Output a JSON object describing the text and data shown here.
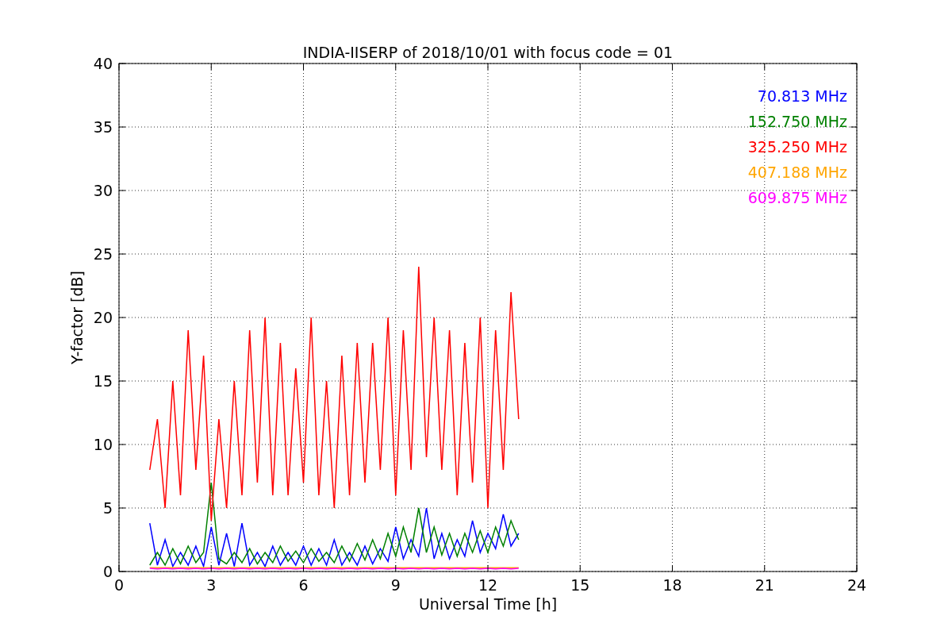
{
  "chart": {
    "chart_data": {
      "type": "line",
      "title": "INDIA-IISERP of 2018/10/01 with focus code = 01",
      "xlabel": "Universal Time [h]",
      "ylabel": "Y-factor [dB]",
      "x": [
        1,
        1.25,
        1.5,
        1.75,
        2,
        2.25,
        2.5,
        2.75,
        3,
        3.25,
        3.5,
        3.75,
        4,
        4.25,
        4.5,
        4.75,
        5,
        5.25,
        5.5,
        5.75,
        6,
        6.25,
        6.5,
        6.75,
        7,
        7.25,
        7.5,
        7.75,
        8,
        8.25,
        8.5,
        8.75,
        9,
        9.25,
        9.5,
        9.75,
        10,
        10.25,
        10.5,
        10.75,
        11,
        11.25,
        11.5,
        11.75,
        12,
        12.25,
        12.5,
        12.75,
        13
      ],
      "series": [
        {
          "name": "70.813 MHz",
          "color": "#0000ff",
          "values": [
            3.8,
            0.5,
            2.5,
            0.4,
            1.5,
            0.5,
            2.0,
            0.4,
            3.5,
            0.5,
            3.0,
            0.4,
            3.8,
            0.5,
            1.5,
            0.4,
            2.0,
            0.5,
            1.5,
            0.5,
            2.0,
            0.5,
            1.8,
            0.5,
            2.5,
            0.5,
            1.5,
            0.5,
            2.0,
            0.6,
            1.8,
            0.8,
            3.5,
            1.0,
            2.5,
            1.2,
            5.0,
            1.0,
            3.0,
            1.0,
            2.5,
            1.2,
            4.0,
            1.5,
            3.0,
            1.8,
            4.5,
            2.0,
            3.0
          ]
        },
        {
          "name": "152.750 MHz",
          "color": "#008000",
          "values": [
            0.5,
            1.5,
            0.5,
            1.8,
            0.6,
            2.0,
            0.7,
            1.5,
            7.0,
            1.0,
            0.6,
            1.5,
            0.7,
            1.8,
            0.6,
            1.5,
            0.7,
            2.0,
            0.8,
            1.6,
            0.7,
            1.8,
            0.8,
            1.5,
            0.7,
            2.0,
            0.8,
            2.2,
            0.9,
            2.5,
            1.0,
            3.0,
            1.2,
            3.5,
            1.5,
            5.0,
            1.5,
            3.5,
            1.3,
            3.0,
            1.2,
            3.0,
            1.5,
            3.2,
            1.5,
            3.5,
            2.0,
            4.0,
            2.5
          ]
        },
        {
          "name": "325.250 MHz",
          "color": "#ff0000",
          "values": [
            8,
            12,
            5,
            15,
            6,
            19,
            8,
            17,
            4,
            12,
            5,
            15,
            6,
            19,
            7,
            20,
            6,
            18,
            6,
            16,
            7,
            20,
            6,
            15,
            5,
            17,
            6,
            18,
            7,
            18,
            8,
            20,
            6,
            19,
            8,
            24,
            9,
            20,
            8,
            19,
            6,
            18,
            7,
            20,
            5,
            19,
            8,
            22,
            12
          ]
        },
        {
          "name": "407.188 MHz",
          "color": "#ffa500",
          "values": [
            0.3,
            0.3,
            0.3,
            0.3,
            0.3,
            0.3,
            0.3,
            0.3,
            0.3,
            0.3,
            0.3,
            0.3,
            0.3,
            0.3,
            0.3,
            0.3,
            0.3,
            0.3,
            0.3,
            0.3,
            0.3,
            0.3,
            0.3,
            0.3,
            0.3,
            0.3,
            0.3,
            0.3,
            0.3,
            0.3,
            0.3,
            0.3,
            0.3,
            0.3,
            0.3,
            0.3,
            0.3,
            0.3,
            0.3,
            0.3,
            0.3,
            0.3,
            0.3,
            0.3,
            0.3,
            0.3,
            0.3,
            0.3,
            0.3
          ]
        },
        {
          "name": "609.875 MHz",
          "color": "#ff00ff",
          "values": [
            0.25,
            0.2,
            0.25,
            0.2,
            0.25,
            0.2,
            0.25,
            0.2,
            0.25,
            0.2,
            0.25,
            0.2,
            0.25,
            0.2,
            0.25,
            0.2,
            0.25,
            0.2,
            0.25,
            0.2,
            0.25,
            0.2,
            0.25,
            0.2,
            0.25,
            0.2,
            0.25,
            0.2,
            0.25,
            0.2,
            0.25,
            0.2,
            0.25,
            0.2,
            0.25,
            0.2,
            0.25,
            0.2,
            0.25,
            0.2,
            0.25,
            0.2,
            0.25,
            0.2,
            0.25,
            0.2,
            0.25,
            0.2,
            0.25
          ]
        }
      ],
      "grid": true,
      "xlim": [
        0,
        24
      ],
      "ylim": [
        0,
        40
      ],
      "xticks": [
        0,
        3,
        6,
        9,
        12,
        15,
        18,
        21,
        24
      ],
      "yticks": [
        0,
        5,
        10,
        15,
        20,
        25,
        30,
        35,
        40
      ]
    }
  }
}
